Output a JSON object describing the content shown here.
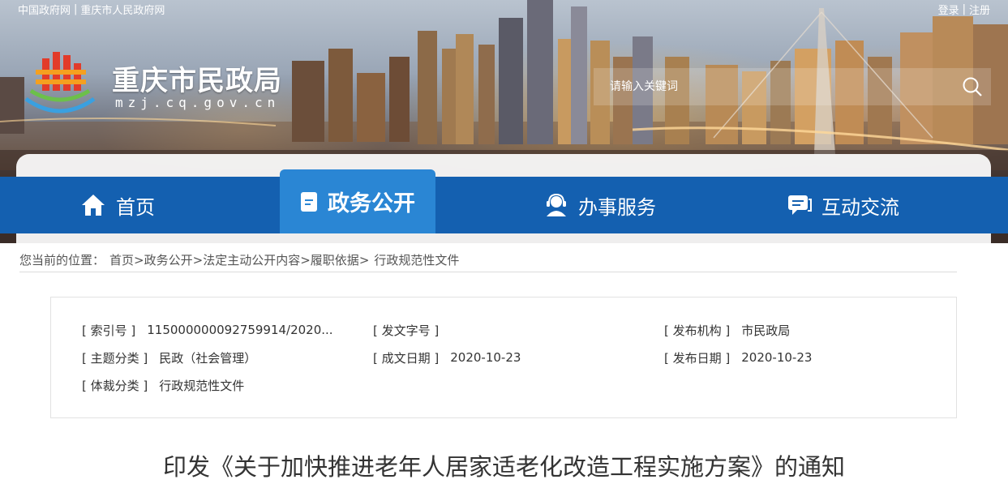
{
  "top_links": {
    "gov_link": "中国政府网",
    "divider": "|",
    "cq_gov_link": "重庆市人民政府网",
    "login": "登录",
    "register": "注册"
  },
  "site": {
    "title": "重庆市民政局",
    "domain": "mzj.cq.gov.cn"
  },
  "search": {
    "placeholder": "请输入关键词"
  },
  "nav": {
    "items": [
      {
        "label": "首页",
        "icon": "home-icon"
      },
      {
        "label": "政务公开",
        "icon": "document-icon",
        "active": true
      },
      {
        "label": "办事服务",
        "icon": "service-person-icon"
      },
      {
        "label": "互动交流",
        "icon": "chat-icon"
      }
    ]
  },
  "breadcrumb": {
    "prefix": "您当前的位置：",
    "items": [
      "首页",
      "政务公开",
      "法定主动公开内容",
      "履职依据",
      "行政规范性文件"
    ],
    "separator": ">"
  },
  "info": {
    "index_label": "[ 索引号 ]",
    "index_value": "115000000092759914/2020...",
    "doc_no_label": "[ 发文字号 ]",
    "doc_no_value": "",
    "issuer_label": "[ 发布机构 ]",
    "issuer_value": "市民政局",
    "topic_label": "[ 主题分类 ]",
    "topic_value": "民政（社会管理）",
    "created_label": "[ 成文日期 ]",
    "created_value": "2020-10-23",
    "published_label": "[ 发布日期 ]",
    "published_value": "2020-10-23",
    "genre_label": "[ 体裁分类 ]",
    "genre_value": "行政规范性文件"
  },
  "document": {
    "title": "印发《关于加快推进老年人居家适老化改造工程实施方案》的通知"
  },
  "colors": {
    "nav_blue": "#1460b0",
    "nav_active": "#2a86d4"
  }
}
